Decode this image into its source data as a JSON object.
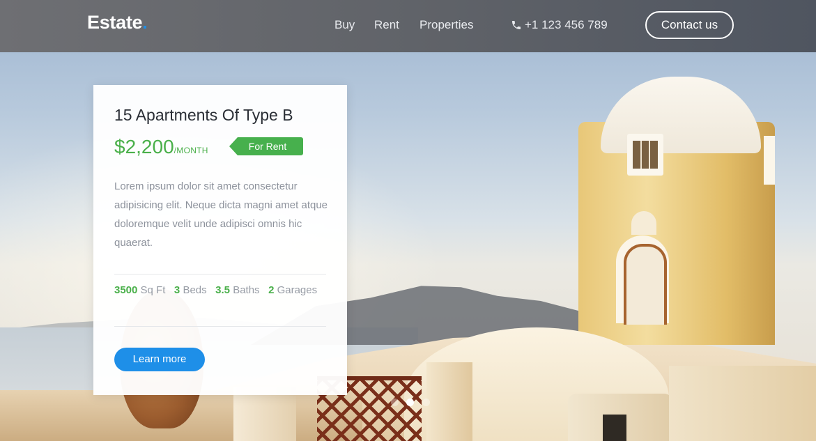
{
  "header": {
    "logo_text": "Estate",
    "logo_dot": ".",
    "nav": [
      {
        "label": "Buy"
      },
      {
        "label": "Rent"
      },
      {
        "label": "Properties"
      }
    ],
    "phone": {
      "icon": "phone-icon",
      "number": "+1 123 456 789"
    },
    "contact_label": "Contact us"
  },
  "listing": {
    "title": "15 Apartments Of Type B",
    "price": "$2,200",
    "price_period": "/MONTH",
    "badge": "For Rent",
    "description": "Lorem ipsum dolor sit amet consectetur adipisicing elit. Neque dicta magni amet atque doloremque velit unde adipisci omnis hic quaerat.",
    "specs": {
      "area_value": "3500",
      "area_label": "Sq Ft",
      "beds_value": "3",
      "beds_label": "Beds",
      "baths_value": "3.5",
      "baths_label": "Baths",
      "garages_value": "2",
      "garages_label": "Garages"
    },
    "learn_more_label": "Learn more"
  },
  "slider": {
    "dot_count": 3,
    "active_index": 2
  },
  "colors": {
    "accent_blue": "#1e8fe8",
    "accent_green": "#4ab04a",
    "header_bg": "#5f6268"
  }
}
